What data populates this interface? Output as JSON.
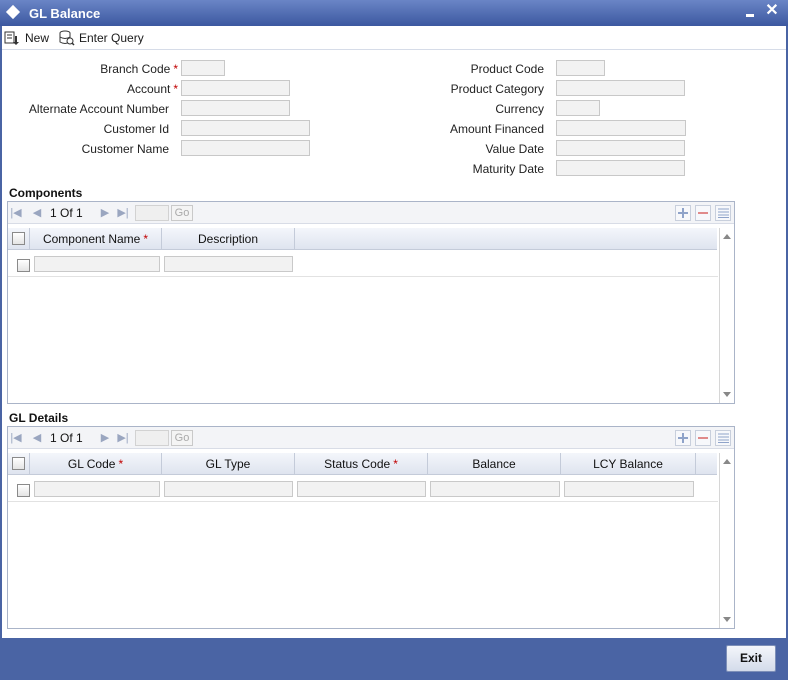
{
  "window": {
    "title": "GL Balance"
  },
  "toolbar": {
    "new_label": "New",
    "enter_query_label": "Enter Query"
  },
  "form": {
    "left": [
      {
        "label": "Branch Code",
        "required": true,
        "value": ""
      },
      {
        "label": "Account",
        "required": true,
        "value": ""
      },
      {
        "label": "Alternate Account Number",
        "required": false,
        "value": ""
      },
      {
        "label": "Customer Id",
        "required": false,
        "value": ""
      },
      {
        "label": "Customer Name",
        "required": false,
        "value": ""
      }
    ],
    "right": [
      {
        "label": "Product Code",
        "value": ""
      },
      {
        "label": "Product Category",
        "value": ""
      },
      {
        "label": "Currency",
        "value": ""
      },
      {
        "label": "Amount Financed",
        "value": ""
      },
      {
        "label": "Value Date",
        "value": ""
      },
      {
        "label": "Maturity Date",
        "value": ""
      }
    ]
  },
  "components": {
    "title": "Components",
    "pager": {
      "current": "1",
      "of_label": "Of",
      "total": "1",
      "go_label": "Go"
    },
    "columns": [
      {
        "label": "Component Name",
        "required": true
      },
      {
        "label": "Description",
        "required": false
      }
    ],
    "rows": [
      [
        "",
        ""
      ]
    ]
  },
  "gl_details": {
    "title": "GL Details",
    "pager": {
      "current": "1",
      "of_label": "Of",
      "total": "1",
      "go_label": "Go"
    },
    "columns": [
      {
        "label": "GL Code",
        "required": true
      },
      {
        "label": "GL Type",
        "required": false
      },
      {
        "label": "Status Code",
        "required": true
      },
      {
        "label": "Balance",
        "required": false
      },
      {
        "label": "LCY Balance",
        "required": false
      }
    ],
    "rows": [
      [
        "",
        "",
        "",
        "",
        ""
      ]
    ]
  },
  "footer": {
    "exit_label": "Exit"
  },
  "required_marker": "*",
  "colors": {
    "frame": "#4a64a4",
    "required": "#c00000",
    "field_bg": "#f2f2f2"
  }
}
